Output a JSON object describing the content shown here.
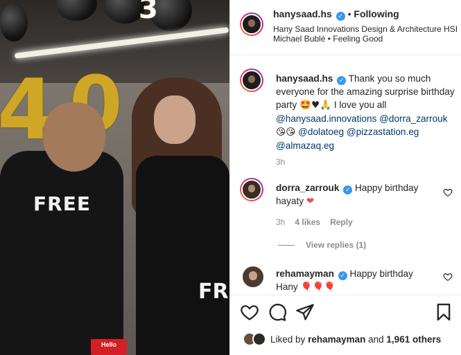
{
  "media": {
    "shirt_text": "FREE",
    "shirt_text_2": "FRE",
    "tag_title": "Hello",
    "balloon_digit": "3"
  },
  "header": {
    "username": "hanysaad.hs",
    "follow_status": "Following",
    "separator": "•",
    "subtitle": "Hany Saad Innovations Design & Architecture HSI",
    "music": "Michael Bublé • Feeling Good"
  },
  "caption": {
    "username": "hanysaad.hs",
    "text_1": "Thank you so much everyone for the amazing surprise birthday party",
    "emoji_1": "🤩♥🙏",
    "text_2": "I love you all",
    "mention_1": "@hanysaad.innovations",
    "mention_2": "@dorra_zarrouk",
    "emoji_2": "😘😘",
    "mention_3": "@dolatoeg",
    "mention_4": "@pizzastation.eg",
    "mention_5": "@almazaq.eg",
    "time": "3h"
  },
  "comments": [
    {
      "username": "dorra_zarrouk",
      "text": "Happy birthday hayaty",
      "emoji": "❤",
      "time": "3h",
      "likes": "4 likes",
      "reply": "Reply",
      "view_replies": "View replies (1)"
    },
    {
      "username": "rehamayman",
      "text": "Happy birthday Hany",
      "emoji": "🎈🎈🎈"
    }
  ],
  "likes": {
    "prefix": "Liked by",
    "user": "rehamayman",
    "and": "and",
    "others": "1,961 others"
  },
  "icons": [
    "heart-icon",
    "comment-icon",
    "share-icon",
    "bookmark-icon",
    "verified-badge-icon"
  ],
  "colors": {
    "link": "#00376b",
    "verified": "#3897f0",
    "heart_red": "#ed4956",
    "muted": "#8e8e8e"
  }
}
